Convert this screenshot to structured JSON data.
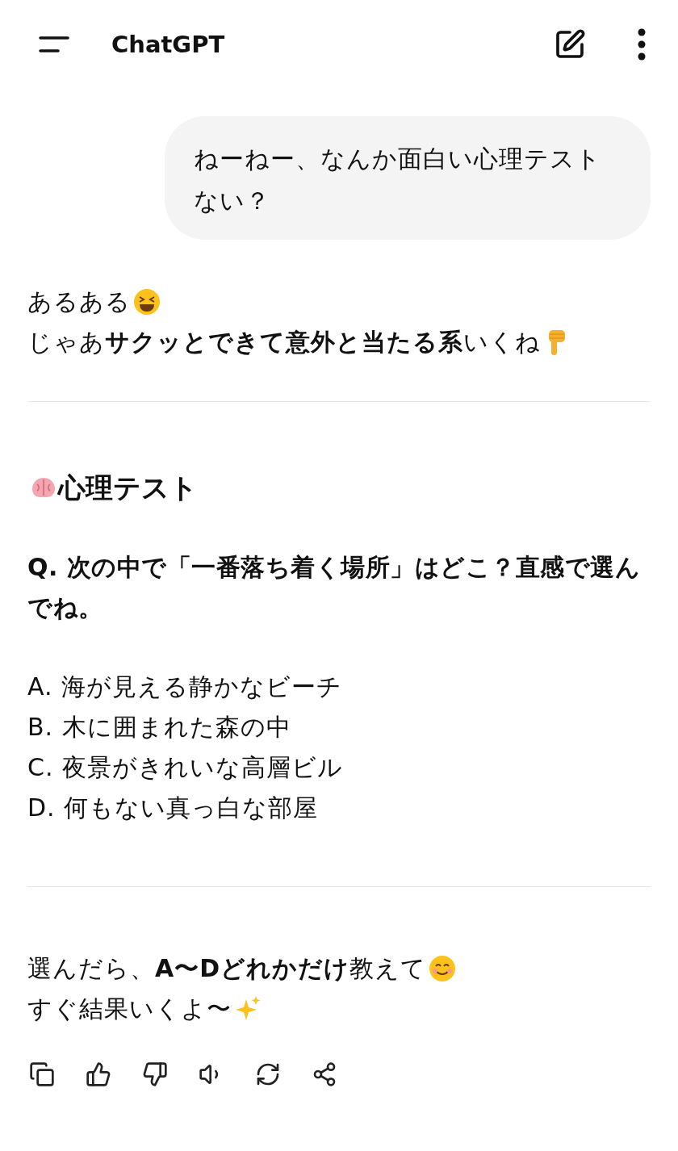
{
  "header": {
    "title": "ChatGPT"
  },
  "user_message": {
    "text": "ねーねー、なんか面白い心理テストない？"
  },
  "assistant": {
    "intro": [
      "あるある",
      "じゃあ**サクッとできて意外と当たる系**いくね"
    ],
    "heading": "心理テスト",
    "question": "Q. 次の中で「一番落ち着く場所」はどこ？直感で選んでね。",
    "options": [
      "A. 海が見える静かなビーチ",
      "B. 木に囲まれた森の中",
      "C. 夜景がきれいな高層ビル",
      "D. 何もない真っ白な部屋"
    ],
    "outro": [
      "選んだら、**A〜Dどれかだけ**教えて",
      "すぐ結果いくよ〜"
    ]
  }
}
